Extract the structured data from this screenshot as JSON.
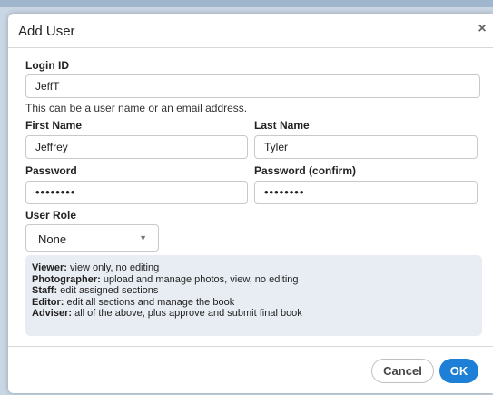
{
  "dialog": {
    "title": "Add User",
    "close_icon": "close-icon"
  },
  "form": {
    "login_id": {
      "label": "Login ID",
      "value": "JeffT",
      "help": "This can be a user name or an email address."
    },
    "first_name": {
      "label": "First Name",
      "value": "Jeffrey"
    },
    "last_name": {
      "label": "Last Name",
      "value": "Tyler"
    },
    "password": {
      "label": "Password",
      "value": "••••••••"
    },
    "password_confirm": {
      "label": "Password (confirm)",
      "value": "••••••••"
    },
    "user_role": {
      "label": "User Role",
      "selected": "None"
    }
  },
  "roles": [
    {
      "name": "Viewer:",
      "desc": " view only, no editing"
    },
    {
      "name": "Photographer:",
      "desc": " upload and manage photos, view, no editing"
    },
    {
      "name": "Staff:",
      "desc": " edit assigned sections"
    },
    {
      "name": "Editor:",
      "desc": " edit all sections and manage the book"
    },
    {
      "name": "Adviser:",
      "desc": " all of the above, plus approve and submit final book"
    }
  ],
  "buttons": {
    "cancel": "Cancel",
    "ok": "OK"
  },
  "colors": {
    "primary": "#1e7fd6",
    "info_panel": "#e8edf3"
  }
}
